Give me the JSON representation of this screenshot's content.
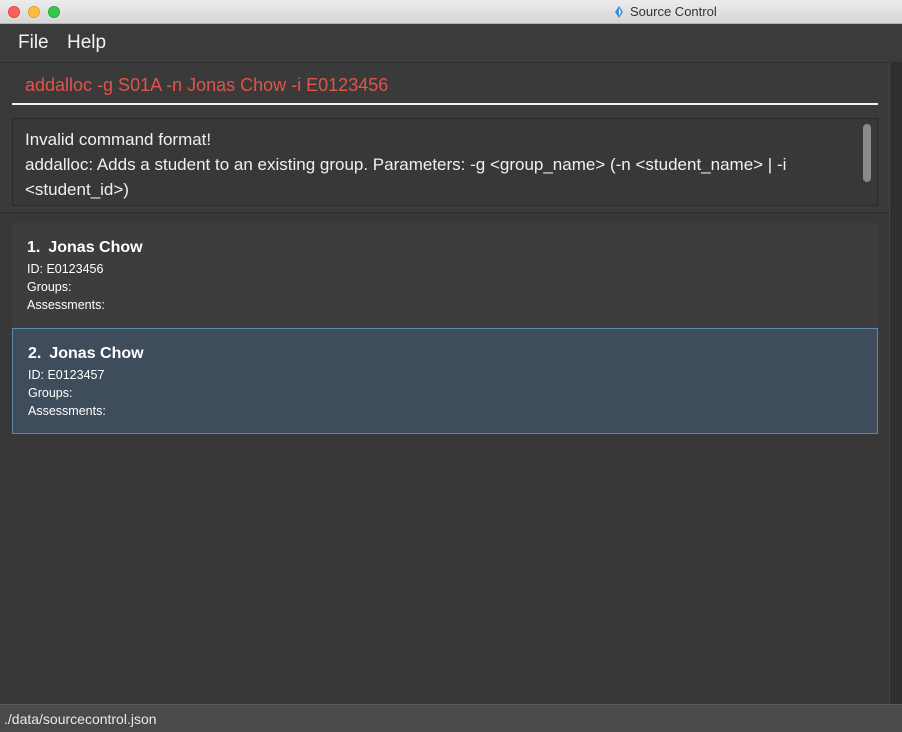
{
  "window": {
    "title": "Source Control",
    "app_icon": "source-control-app-icon"
  },
  "menu": {
    "file": "File",
    "help": "Help"
  },
  "command": {
    "value": "addalloc -g S01A -n Jonas Chow -i E0123456",
    "color": "#e0544a"
  },
  "result": {
    "text": "Invalid command format!\naddalloc: Adds a student to an existing group. Parameters: -g <group_name> (-n <student_name> | -i <student_id>)"
  },
  "students": [
    {
      "index": "1.",
      "name": "Jonas Chow",
      "id": "ID: E0123456",
      "groups": "Groups:",
      "assessments": "Assessments:"
    },
    {
      "index": "2.",
      "name": "Jonas Chow",
      "id": "ID: E0123457",
      "groups": "Groups:",
      "assessments": "Assessments:",
      "selected": true
    }
  ],
  "status": {
    "path": "./data/sourcecontrol.json"
  },
  "colors": {
    "background": "#383838",
    "selected_card": "#3f4c5c",
    "selected_border": "#5a8aa6",
    "error_text": "#e0544a"
  }
}
